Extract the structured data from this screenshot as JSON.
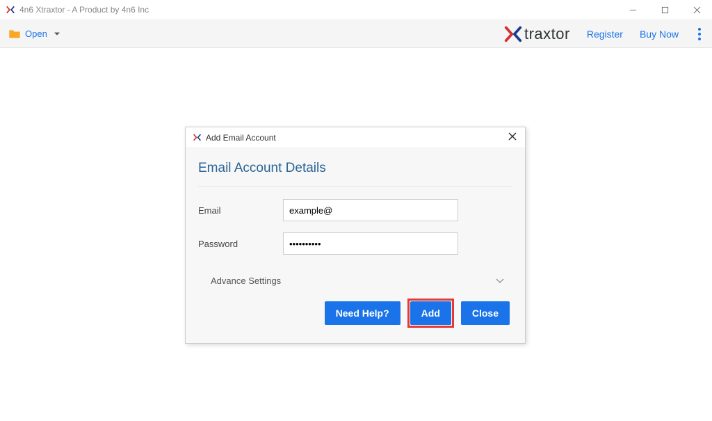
{
  "titlebar": {
    "title": "4n6 Xtraxtor - A Product by 4n6 Inc"
  },
  "toolbar": {
    "open_label": "Open",
    "brand_text": "traxtor",
    "register_label": "Register",
    "buy_label": "Buy Now"
  },
  "dialog": {
    "title": "Add Email Account",
    "section_title": "Email Account Details",
    "email_label": "Email",
    "email_value": "example@",
    "password_label": "Password",
    "password_value": "••••••••••",
    "advance_label": "Advance Settings",
    "need_help_label": "Need Help?",
    "add_label": "Add",
    "close_label": "Close"
  }
}
